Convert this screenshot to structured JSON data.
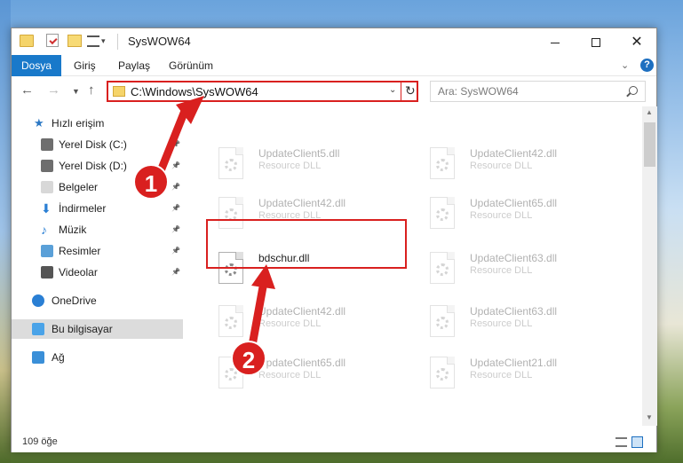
{
  "window": {
    "title": "SysWOW64",
    "quick_access_dropdown": "▾"
  },
  "ribbon": {
    "file_tab": "Dosya",
    "tabs": [
      "Giriş",
      "Paylaş",
      "Görünüm"
    ],
    "help": "?"
  },
  "nav": {
    "address": "C:\\Windows\\SysWOW64",
    "search_placeholder": "Ara: SysWOW64"
  },
  "sidebar": {
    "items": [
      {
        "label": "Hızlı erişim",
        "icon": "star-icon"
      },
      {
        "label": "Yerel Disk (C:)",
        "icon": "drive-icon",
        "pinned": true
      },
      {
        "label": "Yerel Disk (D:)",
        "icon": "drive-icon",
        "pinned": true
      },
      {
        "label": "Belgeler",
        "icon": "document-icon",
        "pinned": true
      },
      {
        "label": "İndirmeler",
        "icon": "download-icon",
        "pinned": true
      },
      {
        "label": "Müzik",
        "icon": "music-icon",
        "pinned": true
      },
      {
        "label": "Resimler",
        "icon": "pictures-icon",
        "pinned": true
      },
      {
        "label": "Videolar",
        "icon": "videos-icon",
        "pinned": true
      },
      {
        "label": "OneDrive",
        "icon": "cloud-icon"
      },
      {
        "label": "Bu bilgisayar",
        "icon": "computer-icon",
        "selected": true
      },
      {
        "label": "Ağ",
        "icon": "network-icon"
      }
    ]
  },
  "files": [
    {
      "name": "UpdateClient5.dll",
      "type": "Resource DLL",
      "faded": true
    },
    {
      "name": "UpdateClient42.dll",
      "type": "Resource DLL",
      "faded": true
    },
    {
      "name": "UpdateClient42.dll",
      "type": "Resource DLL",
      "faded": true
    },
    {
      "name": "UpdateClient65.dll",
      "type": "Resource DLL",
      "faded": true
    },
    {
      "name": "bdschur.dll",
      "type": "",
      "faded": false
    },
    {
      "name": "UpdateClient63.dll",
      "type": "Resource DLL",
      "faded": true
    },
    {
      "name": "UpdateClient42.dll",
      "type": "Resource DLL",
      "faded": true
    },
    {
      "name": "UpdateClient63.dll",
      "type": "Resource DLL",
      "faded": true
    },
    {
      "name": "UpdateClient65.dll",
      "type": "Resource DLL",
      "faded": true
    },
    {
      "name": "UpdateClient21.dll",
      "type": "Resource DLL",
      "faded": true
    }
  ],
  "status": {
    "item_count": "109 öğe"
  },
  "annotations": {
    "step1": "1",
    "step2": "2",
    "color": "#d9201f"
  }
}
